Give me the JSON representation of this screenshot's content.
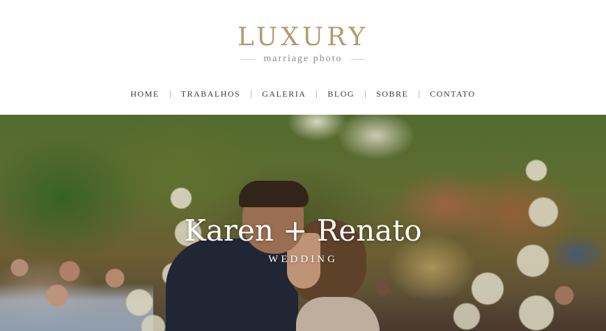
{
  "brand": {
    "title": "LUXURY",
    "subtitle": "marriage photo",
    "accent_color": "#b39a6f"
  },
  "nav": {
    "items": [
      {
        "label": "HOME"
      },
      {
        "label": "TRABALHOS"
      },
      {
        "label": "GALERIA"
      },
      {
        "label": "BLOG"
      },
      {
        "label": "SOBRE"
      },
      {
        "label": "CONTATO"
      }
    ]
  },
  "hero": {
    "title": "Karen + Renato",
    "subtitle": "WEDDING",
    "image": "wedding-ceremony-kiss-photo"
  }
}
